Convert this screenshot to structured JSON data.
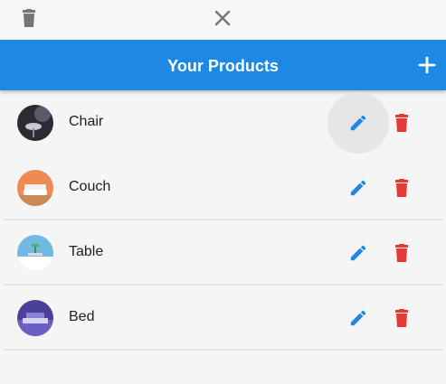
{
  "top_actions": {
    "delete_icon": "trash-icon",
    "close_icon": "close-icon"
  },
  "appbar": {
    "title": "Your Products",
    "add_icon": "plus-icon",
    "color": "#1e88e5"
  },
  "products": [
    {
      "name": "Chair",
      "edit_pressed": true
    },
    {
      "name": "Couch",
      "edit_pressed": false
    },
    {
      "name": "Table",
      "edit_pressed": false
    },
    {
      "name": "Bed",
      "edit_pressed": false
    }
  ],
  "colors": {
    "accent": "#1e88e5",
    "edit": "#1e88e5",
    "delete": "#e53935",
    "background": "#f5f5f5"
  }
}
